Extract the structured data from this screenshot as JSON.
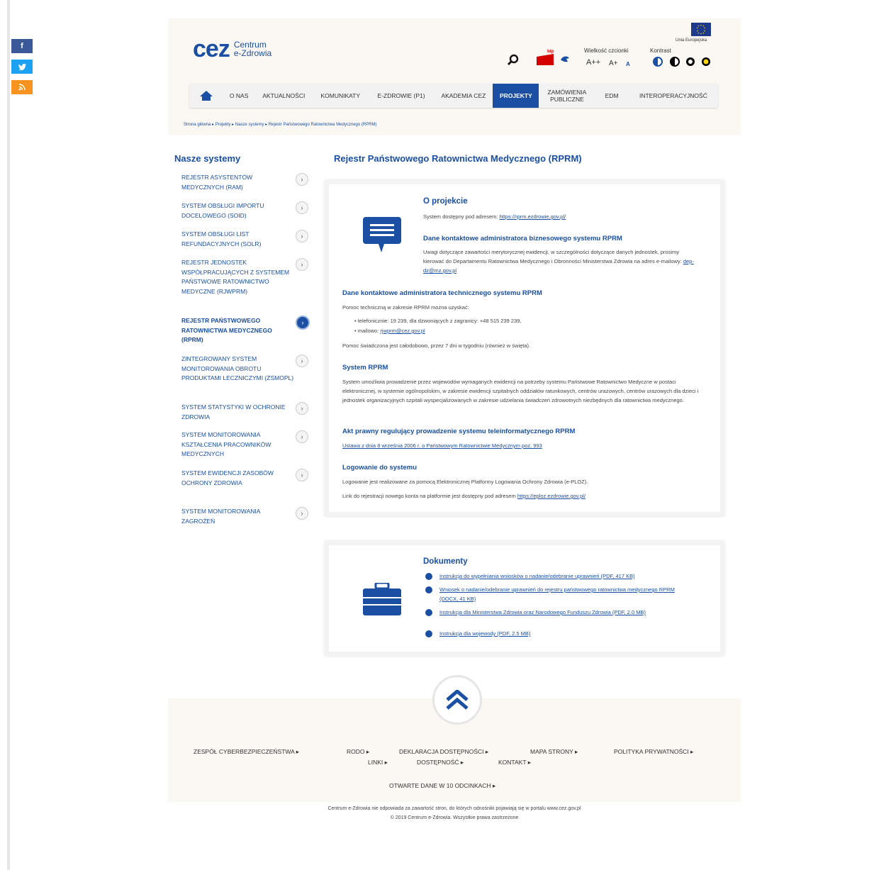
{
  "social": {
    "facebook": "f",
    "twitter": "t",
    "rss": "rss"
  },
  "header": {
    "logo_text": "cez",
    "logo_line1": "Centrum",
    "logo_line2": "e-Zdrowia",
    "eu_label": "Unia Europejska",
    "font_size_label": "Wielkość czcionki",
    "font_sizes": [
      "A++",
      "A+",
      "A"
    ],
    "contrast_label": "Kontrast",
    "bip_label": "bip"
  },
  "nav": {
    "items": [
      "O NAS",
      "AKTUALNOŚCI",
      "KOMUNIKATY",
      "E-ZDROWIE (P1)",
      "AKADEMIA CEZ",
      "PROJEKTY",
      "ZAMÓWIENIA PUBLICZNE",
      "EDM",
      "INTEROPERACYJNOŚĆ"
    ],
    "active": "PROJEKTY"
  },
  "breadcrumb": [
    "Strona główna",
    "Projekty",
    "Nasze systemy",
    "Rejestr Państwowego Ratownictwa Medycznego (RPRM)"
  ],
  "sidebar": {
    "title": "Nasze systemy",
    "items": [
      "REJESTR ASYSTENTÓW MEDYCZNYCH (RAM)",
      "SYSTEM OBSŁUGI IMPORTU DOCELOWEGO (SOID)",
      "SYSTEM OBSŁUGI LIST REFUNDACYJNYCH (SOLR)",
      "REJESTR JEDNOSTEK WSPÓŁPRACUJĄCYCH Z SYSTEMEM PAŃSTWOWE RATOWNICTWO MEDYCZNE (RJWPRM)",
      "REJESTR PAŃSTWOWEGO RATOWNICTWA MEDYCZNEGO (RPRM)",
      "ZINTEGROWANY SYSTEM MONITOROWANIA OBROTU PRODUKTAMI LECZNICZYMI (ZSMOPL)",
      "SYSTEM STATYSTYKI W OCHRONIE ZDROWIA",
      "SYSTEM MONITOROWANIA KSZTAŁCENIA PRACOWNIKÓW MEDYCZNYCH",
      "SYSTEM EWIDENCJI ZASOBÓW OCHRONY ZDROWIA",
      "SYSTEM MONITOROWANIA ZAGROŻEŃ"
    ]
  },
  "main": {
    "title": "Rejestr Państwowego Ratownictwa Medycznego (RPRM)",
    "about_title": "O projekcie",
    "about_text": "System dostępny pod adresem:",
    "about_link": "https://rprm.ezdrowie.gov.pl/",
    "biz_title": "Dane kontaktowe administratora biznesowego systemu RPRM",
    "biz_text": "Uwagi dotyczące zawartości merytorycznej ewidencji, w szczególności dotyczące danych jednostek, prosimy kierować do Departamentu Ratownictwa Medycznego i Obronności Ministerstwa Zdrowia na adres e-mailowy:",
    "biz_link": "dep-dz@mz.gov.pl",
    "tech_title": "Dane kontaktowe administratora technicznego systemu RPRM",
    "tech_intro": "Pomoc techniczną w zakresie RPRM można uzyskać:",
    "tech_phone": "telefonicznie: 19 239, dla dzwoniących z zagranicy: +48 515 239 239,",
    "tech_mail_prefix": "mailowo:",
    "tech_mail": "rjwprm@cez.gov.pl",
    "tech_note": "Pomoc świadczona jest całodobowo, przez 7 dni w tygodniu (również w święta).",
    "sys_title": "System RPRM",
    "sys_text": "System umożliwia prowadzenie przez wojewodów wymaganych ewidencji na potrzeby systemu Państwowe Ratownictwo Medyczne w postaci elektronicznej, w systemie ogólnopolskim, w zakresie ewidencji szpitalnych oddziałów ratunkowych, centrów urazowych, centrów urazowych dla dzieci i jednostek organizacyjnych szpitali wyspecjalizowanych w zakresie udzielania świadczeń zdrowotnych niezbędnych dla ratownictwa medycznego.",
    "act_title": "Akt prawny regulujący prowadzenie systemu teleinformatycznego RPRM",
    "act_link": "Ustawa z dnia 8 września 2006 r. o Państwowym Ratownictwie Medycznym poz. 993",
    "login_title": "Logowanie do systemu",
    "login_text": "Logowanie jest realizowane za pomocą Elektronicznej Platformy Logowania Ochrony Zdrowia (e-PLOZ).",
    "login_text2": "Link do rejestracji nowego konta na platformie jest dostępny pod adresem",
    "login_link": "https://eploz.ezdrowie.gov.pl/"
  },
  "documents": {
    "title": "Dokumenty",
    "items": [
      "Instrukcja do wypełniania wniosków o nadanie/odebranie uprawnień (PDF, 417 KB)",
      "Wniosek o nadanie/odebranie uprawnień do rejestru państwowego ratownictwa medycznego RPRM (DOCX, 41 KB)",
      "Instrukcja dla Ministerstwa Zdrowia oraz Narodowego Funduszu Zdrowia (PDF, 2.0 MB)",
      "Instrukcja dla wojewody (PDF, 2.5 MB)"
    ]
  },
  "footer": {
    "row1": [
      "ZESPÓŁ CYBERBEZPIECZEŃSTWA",
      "RODO",
      "DEKLARACJA DOSTĘPNOŚCI",
      "MAPA STRONY",
      "POLITYKA PRYWATNOŚCI"
    ],
    "row2": [
      "LINKI",
      "DOSTĘPNOŚĆ",
      "KONTAKT"
    ],
    "row3": [
      "OTWARTE DANE W 10 ODCINKACH"
    ],
    "disclaimer": "Centrum e-Zdrowia nie odpowiada za zawartość stron, do których odnośniki pojawiają się w portalu www.cez.gov.pl",
    "copyright": "© 2019 Centrum e-Zdrowia. Wszystkie prawa zastrzeżone"
  },
  "colors": {
    "primary": "#1a4fa3",
    "facebook": "#3b5998",
    "twitter": "#1da1f2",
    "rss": "#f7931e",
    "header_bg": "#fbf8f3"
  }
}
